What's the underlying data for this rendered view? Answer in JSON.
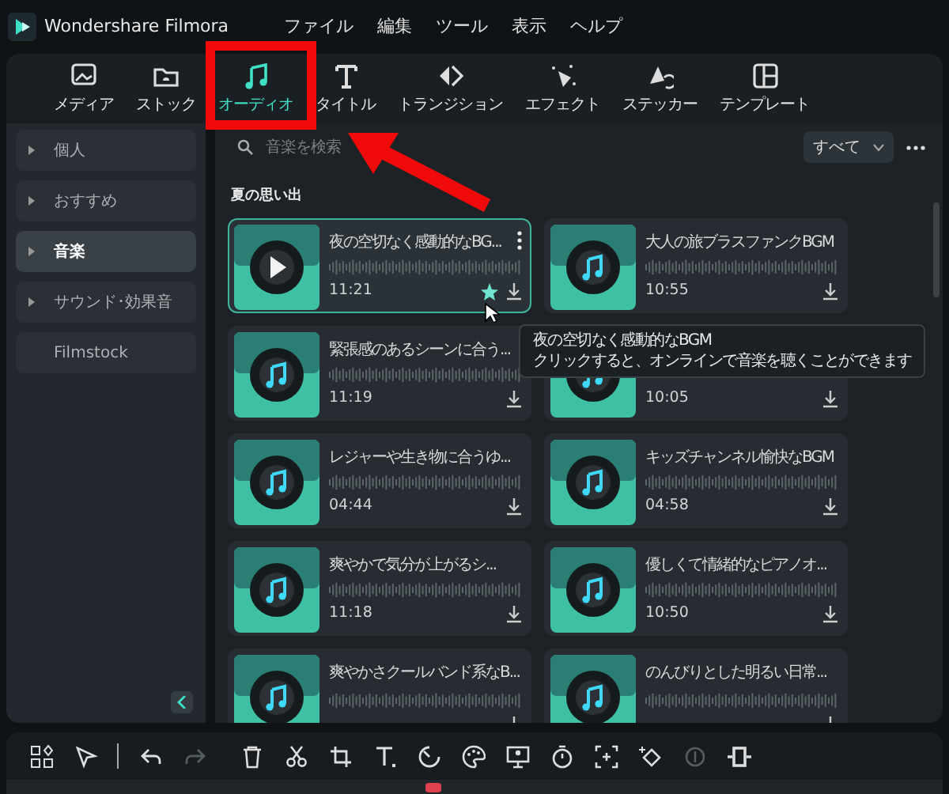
{
  "app": {
    "title": "Wondershare Filmora"
  },
  "menu": [
    "ファイル",
    "編集",
    "ツール",
    "表示",
    "ヘルプ"
  ],
  "tabs": [
    {
      "label": "メディア",
      "selected": false
    },
    {
      "label": "ストック",
      "selected": false
    },
    {
      "label": "オーディオ",
      "selected": true
    },
    {
      "label": "タイトル",
      "selected": false
    },
    {
      "label": "トランジション",
      "selected": false
    },
    {
      "label": "エフェクト",
      "selected": false
    },
    {
      "label": "ステッカー",
      "selected": false
    },
    {
      "label": "テンプレート",
      "selected": false
    }
  ],
  "sidebar": {
    "items": [
      {
        "label": "個人",
        "selected": false,
        "expandable": true
      },
      {
        "label": "おすすめ",
        "selected": false,
        "expandable": true
      },
      {
        "label": "音楽",
        "selected": true,
        "expandable": true
      },
      {
        "label": "サウンド･効果音",
        "selected": false,
        "expandable": true
      },
      {
        "label": "Filmstock",
        "selected": false,
        "expandable": false
      }
    ]
  },
  "search": {
    "placeholder": "音楽を検索"
  },
  "filter": {
    "value": "すべて"
  },
  "section_title": "夏の思い出",
  "tracks": [
    {
      "title": "夜の空切なく感動的なBG...",
      "duration": "11:21",
      "hovered": true
    },
    {
      "title": "大人の旅ブラスファンクBGM",
      "duration": "10:55",
      "hovered": false
    },
    {
      "title": "緊張感のあるシーンに合う...",
      "duration": "11:19",
      "hovered": false
    },
    {
      "duration": "10:05",
      "hovered": false
    },
    {
      "title": "レジャーや生き物に合うゆ...",
      "duration": "04:44",
      "hovered": false
    },
    {
      "title": "キッズチャンネル愉快なBGM",
      "duration": "04:58",
      "hovered": false
    },
    {
      "title": "爽やかで気分が上がるシ...",
      "duration": "11:18",
      "hovered": false
    },
    {
      "title": "優しくて情緒的なピアノオ...",
      "duration": "10:50",
      "hovered": false
    },
    {
      "title": "爽やかさクールバンド系なB...",
      "hovered": false
    },
    {
      "title": "のんびりとした明るい日常...",
      "hovered": false
    }
  ],
  "tooltip": {
    "title": "夜の空切なく感動的なBGM",
    "text": "クリックすると、オンラインで音楽を聴くことができます"
  },
  "bottom_toolbar": [
    {
      "disabled": false
    },
    {
      "disabled": false
    },
    {
      "disabled": false
    },
    {
      "disabled": true
    },
    {
      "disabled": false
    },
    {
      "disabled": false
    },
    {
      "disabled": false
    },
    {
      "disabled": false
    },
    {
      "disabled": false
    },
    {
      "disabled": false
    },
    {
      "disabled": false
    },
    {
      "disabled": false
    },
    {
      "disabled": false
    },
    {
      "disabled": false
    },
    {
      "disabled": true
    },
    {
      "disabled": false
    }
  ]
}
